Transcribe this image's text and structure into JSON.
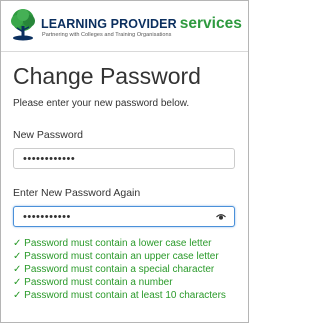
{
  "header": {
    "brand_main": "LEARNING PROVIDER",
    "brand_accent": "services",
    "tagline": "Partnering with Colleges and Training Organisations",
    "logo_icon": "tree-logo-icon",
    "colors": {
      "navy": "#0b2f5f",
      "green": "#2e9a3f"
    }
  },
  "page": {
    "title": "Change Password",
    "intro": "Please enter your new password below."
  },
  "form": {
    "new_password_label": "New Password",
    "new_password_value": "••••••••••••",
    "confirm_password_label": "Enter New Password Again",
    "confirm_password_value": "•••••••••••",
    "reveal_icon": "eye-icon"
  },
  "rules": [
    {
      "icon": "check-icon",
      "text": "✓ Password must contain a lower case letter"
    },
    {
      "icon": "check-icon",
      "text": "✓ Password must contain an upper case letter"
    },
    {
      "icon": "check-icon",
      "text": "✓ Password must contain a special character"
    },
    {
      "icon": "check-icon",
      "text": "✓ Password must contain a number"
    },
    {
      "icon": "check-icon",
      "text": "✓ Password must contain at least 10 characters"
    }
  ],
  "colors": {
    "rule_ok": "#2a9a2a",
    "focus": "#4a90d9"
  }
}
